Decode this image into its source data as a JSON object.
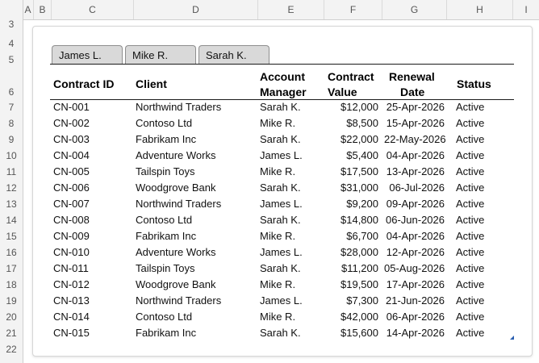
{
  "columns": [
    "A",
    "B",
    "C",
    "D",
    "E",
    "F",
    "G",
    "H",
    "I"
  ],
  "row_numbers": [
    "3",
    "4",
    "5",
    "6",
    "7",
    "8",
    "9",
    "10",
    "11",
    "12",
    "13",
    "14",
    "15",
    "16",
    "17",
    "18",
    "19",
    "20",
    "21",
    "22"
  ],
  "tabs": [
    "James L.",
    "Mike R.",
    "Sarah K."
  ],
  "headers": {
    "id": "Contract ID",
    "client": "Client",
    "manager_l1": "Account",
    "manager_l2": "Manager",
    "value_l1": "Contract",
    "value_l2": "Value",
    "date_l1": "Renewal",
    "date_l2": "Date",
    "status": "Status"
  },
  "rows": [
    {
      "id": "CN-001",
      "client": "Northwind Traders",
      "manager": "Sarah K.",
      "value": "$12,000",
      "date": "25-Apr-2026",
      "status": "Active"
    },
    {
      "id": "CN-002",
      "client": "Contoso Ltd",
      "manager": "Mike R.",
      "value": "$8,500",
      "date": "15-Apr-2026",
      "status": "Active"
    },
    {
      "id": "CN-003",
      "client": "Fabrikam Inc",
      "manager": "Sarah K.",
      "value": "$22,000",
      "date": "22-May-2026",
      "status": "Active"
    },
    {
      "id": "CN-004",
      "client": "Adventure Works",
      "manager": "James L.",
      "value": "$5,400",
      "date": "04-Apr-2026",
      "status": "Active"
    },
    {
      "id": "CN-005",
      "client": "Tailspin Toys",
      "manager": "Mike R.",
      "value": "$17,500",
      "date": "13-Apr-2026",
      "status": "Active"
    },
    {
      "id": "CN-006",
      "client": "Woodgrove Bank",
      "manager": "Sarah K.",
      "value": "$31,000",
      "date": "06-Jul-2026",
      "status": "Active"
    },
    {
      "id": "CN-007",
      "client": "Northwind Traders",
      "manager": "James L.",
      "value": "$9,200",
      "date": "09-Apr-2026",
      "status": "Active"
    },
    {
      "id": "CN-008",
      "client": "Contoso Ltd",
      "manager": "Sarah K.",
      "value": "$14,800",
      "date": "06-Jun-2026",
      "status": "Active"
    },
    {
      "id": "CN-009",
      "client": "Fabrikam Inc",
      "manager": "Mike R.",
      "value": "$6,700",
      "date": "04-Apr-2026",
      "status": "Active"
    },
    {
      "id": "CN-010",
      "client": "Adventure Works",
      "manager": "James L.",
      "value": "$28,000",
      "date": "12-Apr-2026",
      "status": "Active"
    },
    {
      "id": "CN-011",
      "client": "Tailspin Toys",
      "manager": "Sarah K.",
      "value": "$11,200",
      "date": "05-Aug-2026",
      "status": "Active"
    },
    {
      "id": "CN-012",
      "client": "Woodgrove Bank",
      "manager": "Mike R.",
      "value": "$19,500",
      "date": "17-Apr-2026",
      "status": "Active"
    },
    {
      "id": "CN-013",
      "client": "Northwind Traders",
      "manager": "James L.",
      "value": "$7,300",
      "date": "21-Jun-2026",
      "status": "Active"
    },
    {
      "id": "CN-014",
      "client": "Contoso Ltd",
      "manager": "Mike R.",
      "value": "$42,000",
      "date": "06-Apr-2026",
      "status": "Active"
    },
    {
      "id": "CN-015",
      "client": "Fabrikam Inc",
      "manager": "Sarah K.",
      "value": "$15,600",
      "date": "14-Apr-2026",
      "status": "Active"
    }
  ],
  "colors": {
    "header_bg": "#f3f3f3",
    "tab_bg": "#d9d9d9",
    "accent_handle": "#2a5fb0"
  },
  "icons": {
    "resize_handle": "resize-handle-icon"
  }
}
